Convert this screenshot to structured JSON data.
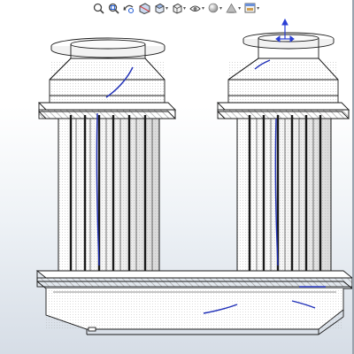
{
  "app": {
    "toolbar": {
      "items": [
        {
          "icon": "zoom-to-fit-icon"
        },
        {
          "icon": "zoom-to-area-icon"
        },
        {
          "icon": "previous-view-icon"
        },
        {
          "icon": "section-view-icon"
        },
        {
          "icon": "view-orientation-icon",
          "has_dropdown": true
        },
        {
          "icon": "display-style-icon",
          "has_dropdown": true
        },
        {
          "icon": "hide-show-items-icon",
          "has_dropdown": true
        },
        {
          "icon": "edit-appearance-icon",
          "has_dropdown": true
        },
        {
          "icon": "apply-scene-icon",
          "has_dropdown": true
        },
        {
          "icon": "view-settings-icon",
          "has_dropdown": true
        }
      ]
    },
    "colors": {
      "sketch_line": "#1f2fb8",
      "model_edge": "#1a1a1a",
      "hatch": "#9a9a9a",
      "triad": "#2b3fd6"
    },
    "model": {
      "name": "",
      "parts": [
        "left-column",
        "right-column",
        "base-tank"
      ]
    }
  }
}
